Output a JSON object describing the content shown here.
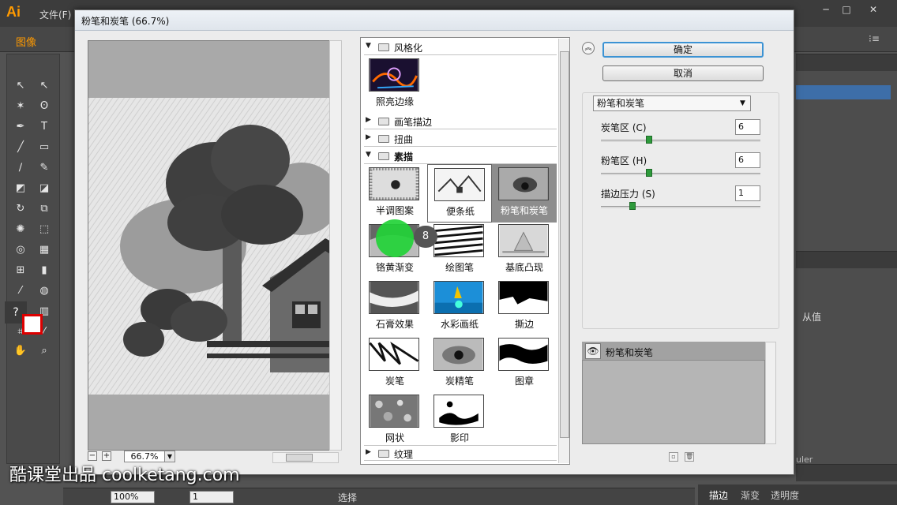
{
  "app": {
    "logo": "Ai",
    "menu_file": "文件(F)",
    "doc_label": "图像",
    "panel_menu_icon": "menu-icon",
    "right_panel_text": "从值",
    "right_panel_ruler": "uler",
    "status": {
      "zoom": "100%",
      "page": "1",
      "select_label": "选择"
    },
    "bottom_tabs": [
      "描边",
      "渐变",
      "透明度"
    ]
  },
  "dialog": {
    "title": "粉笔和炭笔 (66.7%)",
    "zoom_value": "66.7%",
    "ok_label": "确定",
    "cancel_label": "取消",
    "filter_select_value": "粉笔和炭笔",
    "params": [
      {
        "label": "炭笔区 (C)",
        "value": "6",
        "fraction": 0.3
      },
      {
        "label": "粉笔区 (H)",
        "value": "6",
        "fraction": 0.3
      },
      {
        "label": "描边压力 (S)",
        "value": "1",
        "fraction": 0.2
      }
    ],
    "layer_name": "粉笔和炭笔",
    "categories": [
      {
        "label": "风格化",
        "expanded": true,
        "filters": [
          {
            "label": "照亮边缘"
          }
        ]
      },
      {
        "label": "画笔描边",
        "expanded": false
      },
      {
        "label": "扭曲",
        "expanded": false
      },
      {
        "label": "素描",
        "expanded": true,
        "filters": [
          {
            "label": "半调图案"
          },
          {
            "label": "便条纸"
          },
          {
            "label": "粉笔和炭笔",
            "selected": true
          },
          {
            "label": "铬黄渐变"
          },
          {
            "label": "绘图笔"
          },
          {
            "label": "基底凸现"
          },
          {
            "label": "石膏效果"
          },
          {
            "label": "水彩画纸"
          },
          {
            "label": "撕边"
          },
          {
            "label": "炭笔"
          },
          {
            "label": "炭精笔"
          },
          {
            "label": "图章"
          },
          {
            "label": "网状"
          },
          {
            "label": "影印"
          }
        ]
      },
      {
        "label": "纹理",
        "expanded": false
      }
    ]
  },
  "overlay": {
    "cursor_badge": "8",
    "watermark": "酷课堂出品 coolketang.com"
  },
  "colors": {
    "ok_border": "#3c93d4",
    "slider_thumb": "#2e9a3b",
    "cursor": "#22d337",
    "ai_accent": "#ff9a00"
  }
}
